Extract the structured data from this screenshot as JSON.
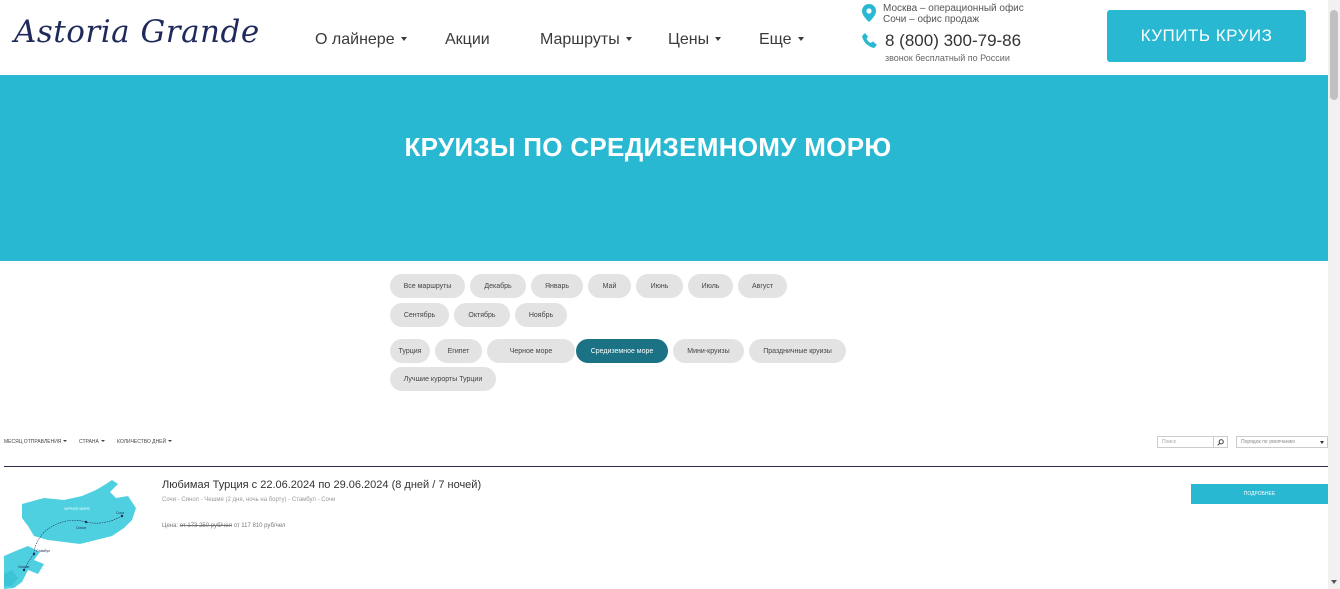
{
  "header": {
    "logo": "Astoria Grande",
    "nav": [
      {
        "label": "О лайнере",
        "dropdown": true
      },
      {
        "label": "Акции",
        "dropdown": false
      },
      {
        "label": "Маршруты",
        "dropdown": true
      },
      {
        "label": "Цены",
        "dropdown": true
      },
      {
        "label": "Еще",
        "dropdown": true
      }
    ],
    "office_line1": "Москва – операционный офис",
    "office_line2": "Сочи – офис продаж",
    "phone": "8 (800) 300-79-86",
    "phone_note": "звонок бесплатный по России",
    "buy_button": "КУПИТЬ КРУИЗ",
    "icons": {
      "location": "location-pin-icon",
      "phone": "phone-icon"
    }
  },
  "hero": {
    "title": "КРУИЗЫ ПО СРЕДИЗЕМНОМУ МОРЮ"
  },
  "month_filters": [
    "Все маршруты",
    "Декабрь",
    "Январь",
    "Май",
    "Июнь",
    "Июль",
    "Август",
    "Сентябрь",
    "Октябрь",
    "Ноябрь"
  ],
  "destination_filters": [
    "Турция",
    "Египет",
    "Черное море",
    "Средиземное море",
    "Мини-круизы",
    "Праздничные круизы",
    "Лучшие курорты Турции"
  ],
  "active_destination": "Средиземное море",
  "filter_bar": {
    "month": "МЕСЯЦ ОТПРАВЛЕНИЯ",
    "country": "СТРАНА",
    "days": "КОЛИЧЕСТВО ДНЕЙ",
    "search_placeholder": "Поиск",
    "sort": "Порядок по умолчанию"
  },
  "cruise": {
    "title": "Любимая Турция с 22.06.2024 по 29.06.2024 (8 дней / 7 ночей)",
    "route": "Сочи - Синоп - Чешме (2 дня, ночь на борту) - Стамбул - Сочи",
    "price_label": "Цена:",
    "old_price": "от 173 250 руб/чел",
    "new_price": "от 117 810 руб/чел",
    "details_button": "ПОДРОБНЕЕ",
    "map_labels": [
      "ЧЕРНОЕ МОРЕ",
      "Сочи",
      "Синоп",
      "Стамбул",
      "Чешме"
    ]
  },
  "colors": {
    "accent": "#29b8d2",
    "active_pill": "#1a7284",
    "logo": "#1f2a5a"
  }
}
